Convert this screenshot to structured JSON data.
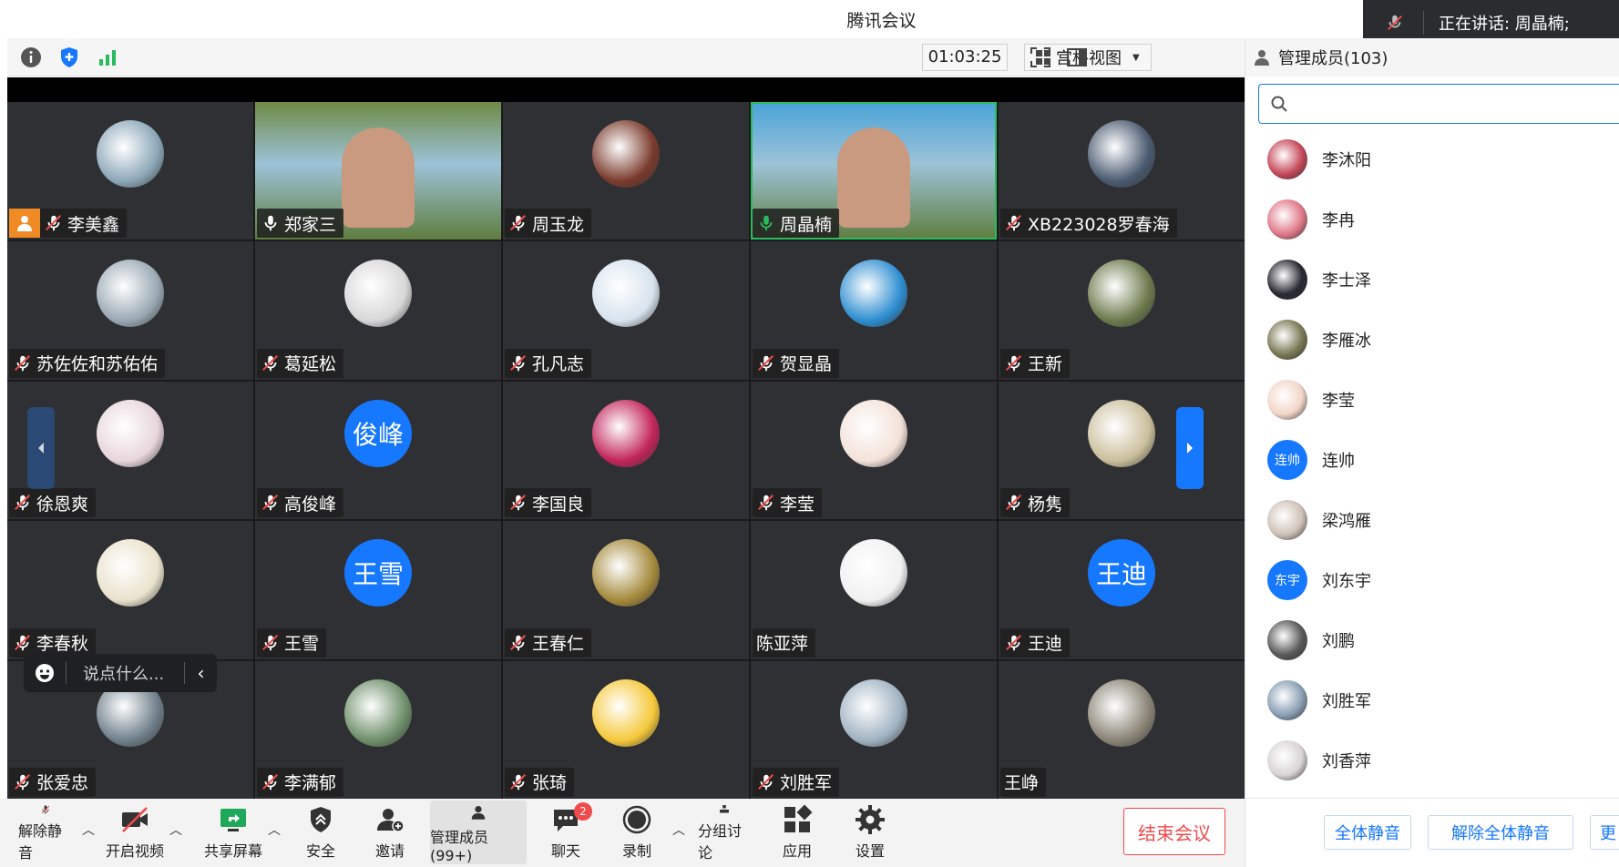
{
  "window": {
    "title": "腾讯会议"
  },
  "speaking": {
    "label": "正在讲话: 周晶楠;"
  },
  "toolbar": {
    "timer": "01:03:25",
    "view_mode": "宫格视图"
  },
  "panel": {
    "title": "管理成员(103)",
    "search_placeholder": "",
    "members": [
      {
        "name": "李沐阳",
        "avatar": "photo",
        "color": "#c64a5b"
      },
      {
        "name": "李冉",
        "avatar": "photo",
        "color": "#e07a8a"
      },
      {
        "name": "李士泽",
        "avatar": "photo",
        "color": "#2a2a33"
      },
      {
        "name": "李雁冰",
        "avatar": "photo",
        "color": "#7b7a55"
      },
      {
        "name": "李莹",
        "avatar": "photo",
        "color": "#f2d6c8"
      },
      {
        "name": "连帅",
        "avatar": "text",
        "text": "连帅"
      },
      {
        "name": "梁鸿雁",
        "avatar": "photo",
        "color": "#cfc2b8"
      },
      {
        "name": "刘东宇",
        "avatar": "text",
        "text": "东宇"
      },
      {
        "name": "刘鹏",
        "avatar": "photo",
        "color": "#5a5a5a"
      },
      {
        "name": "刘胜军",
        "avatar": "photo",
        "color": "#8aa0b4"
      },
      {
        "name": "刘香萍",
        "avatar": "photo",
        "color": "#d9d4d6"
      }
    ],
    "mute_all": "全体静音",
    "unmute_all": "解除全体静音",
    "more": "更"
  },
  "grid": [
    {
      "name": "李美鑫",
      "avatar": "photo",
      "color": "#8ca7b8",
      "host": true,
      "mic": "muted"
    },
    {
      "name": "郑家三",
      "avatar": "video",
      "color": "#6f8a46",
      "mic": "on"
    },
    {
      "name": "周玉龙",
      "avatar": "photo",
      "color": "#7a3a2c",
      "mic": "muted"
    },
    {
      "name": "周晶楠",
      "avatar": "video",
      "color": "#4aa3d8",
      "mic": "speaking",
      "active": true
    },
    {
      "name": "XB223028罗春海",
      "avatar": "photo",
      "color": "#4a5a70",
      "mic": "muted"
    },
    {
      "name": "苏佐佐和苏佑佑",
      "avatar": "photo",
      "color": "#9aa9b4",
      "mic": "muted"
    },
    {
      "name": "葛延松",
      "avatar": "photo",
      "color": "#d8d8d8",
      "mic": "muted"
    },
    {
      "name": "孔凡志",
      "avatar": "photo",
      "color": "#d7e3ee",
      "mic": "muted"
    },
    {
      "name": "贺显晶",
      "avatar": "photo",
      "color": "#2d8ed1",
      "mic": "muted"
    },
    {
      "name": "王新",
      "avatar": "photo",
      "color": "#6c7a4c",
      "mic": "muted"
    },
    {
      "name": "徐恩爽",
      "avatar": "photo",
      "color": "#e8d6dc",
      "mic": "muted"
    },
    {
      "name": "高俊峰",
      "avatar": "text",
      "text": "俊峰",
      "mic": "muted"
    },
    {
      "name": "李国良",
      "avatar": "photo",
      "color": "#c2245a",
      "mic": "muted"
    },
    {
      "name": "李莹",
      "avatar": "photo",
      "color": "#f3e2d9",
      "mic": "muted"
    },
    {
      "name": "杨隽",
      "avatar": "photo",
      "color": "#cbbf9c",
      "mic": "muted"
    },
    {
      "name": "李春秋",
      "avatar": "photo",
      "color": "#e9e2cc",
      "mic": "muted"
    },
    {
      "name": "王雪",
      "avatar": "text",
      "text": "王雪",
      "mic": "muted"
    },
    {
      "name": "王春仁",
      "avatar": "photo",
      "color": "#a58a3c",
      "mic": "muted"
    },
    {
      "name": "陈亚萍",
      "avatar": "photo",
      "color": "#f1f1f1",
      "mic": "none"
    },
    {
      "name": "王迪",
      "avatar": "text",
      "text": "王迪",
      "mic": "muted"
    },
    {
      "name": "张爱忠",
      "avatar": "photo",
      "color": "#6f7f8a",
      "mic": "muted"
    },
    {
      "name": "李满郁",
      "avatar": "photo",
      "color": "#6e8f6a",
      "mic": "muted"
    },
    {
      "name": "张琦",
      "avatar": "photo",
      "color": "#f5c93b",
      "mic": "muted"
    },
    {
      "name": "刘胜军",
      "avatar": "photo",
      "color": "#a0b3c2",
      "mic": "muted"
    },
    {
      "name": "王峥",
      "avatar": "photo",
      "color": "#8a8476",
      "mic": "none"
    }
  ],
  "chat_bubble": {
    "placeholder": "说点什么..."
  },
  "bottombar": {
    "unmute": "解除静音",
    "video": "开启视频",
    "share": "共享屏幕",
    "security": "安全",
    "invite": "邀请",
    "members": "管理成员(99+)",
    "chat": "聊天",
    "chat_badge": "2",
    "record": "录制",
    "breakout": "分组讨论",
    "apps": "应用",
    "settings": "设置",
    "end": "结束会议"
  },
  "colors": {
    "accent": "#1677ff",
    "danger": "#f04a4a",
    "speaking": "#2bbb5e",
    "host": "#f08a24"
  }
}
